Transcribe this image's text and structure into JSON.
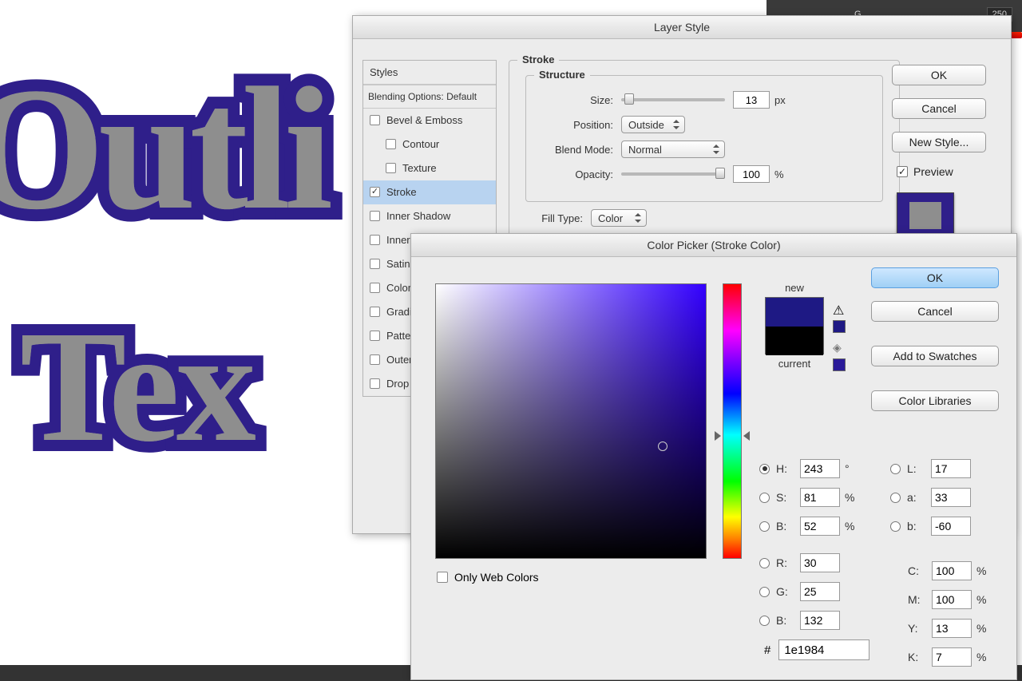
{
  "rightPanel": {
    "label": "G",
    "value": "250"
  },
  "canvas": {
    "line1": "Outli",
    "line2": "Tex"
  },
  "layerStyle": {
    "title": "Layer Style",
    "stylesHeader": "Styles",
    "blendingOptions": "Blending Options: Default",
    "items": {
      "bevel": "Bevel & Emboss",
      "contour": "Contour",
      "texture": "Texture",
      "stroke": "Stroke",
      "innerShadow": "Inner Shadow",
      "innerGlow": "Inner Glow",
      "satin": "Satin",
      "colorOverlay": "Color Overlay",
      "gradientOverlay": "Gradient Overlay",
      "patternOverlay": "Pattern Overlay",
      "outerGlow": "Outer Glow",
      "dropShadow": "Drop Shadow"
    },
    "strokeGroup": "Stroke",
    "structureGroup": "Structure",
    "sizeLabel": "Size:",
    "sizeValue": "13",
    "sizeUnit": "px",
    "positionLabel": "Position:",
    "positionValue": "Outside",
    "blendModeLabel": "Blend Mode:",
    "blendModeValue": "Normal",
    "opacityLabel": "Opacity:",
    "opacityValue": "100",
    "opacityUnit": "%",
    "fillTypeLabel": "Fill Type:",
    "fillTypeValue": "Color",
    "okBtn": "OK",
    "cancelBtn": "Cancel",
    "newStyleBtn": "New Style...",
    "previewLabel": "Preview"
  },
  "colorPicker": {
    "title": "Color Picker (Stroke Color)",
    "okBtn": "OK",
    "cancelBtn": "Cancel",
    "addSwatches": "Add to Swatches",
    "colorLibraries": "Color Libraries",
    "newLabel": "new",
    "currentLabel": "current",
    "onlyWeb": "Only Web Colors",
    "H": {
      "l": "H:",
      "v": "243",
      "u": "°"
    },
    "S": {
      "l": "S:",
      "v": "81",
      "u": "%"
    },
    "Bv": {
      "l": "B:",
      "v": "52",
      "u": "%"
    },
    "R": {
      "l": "R:",
      "v": "30"
    },
    "G": {
      "l": "G:",
      "v": "25"
    },
    "B2": {
      "l": "B:",
      "v": "132"
    },
    "L": {
      "l": "L:",
      "v": "17"
    },
    "a": {
      "l": "a:",
      "v": "33"
    },
    "b": {
      "l": "b:",
      "v": "-60"
    },
    "C": {
      "l": "C:",
      "v": "100",
      "u": "%"
    },
    "M": {
      "l": "M:",
      "v": "100",
      "u": "%"
    },
    "Y": {
      "l": "Y:",
      "v": "13",
      "u": "%"
    },
    "K": {
      "l": "K:",
      "v": "7",
      "u": "%"
    },
    "hexLabel": "#",
    "hexValue": "1e1984"
  }
}
